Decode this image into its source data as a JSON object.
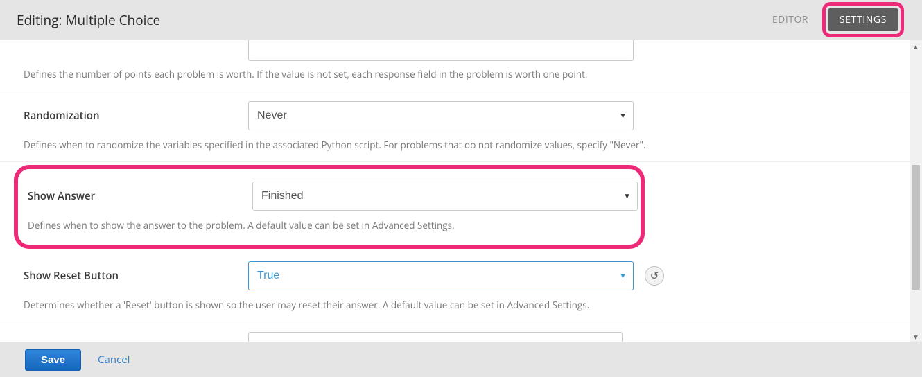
{
  "header": {
    "title": "Editing: Multiple Choice",
    "tabs": {
      "editor": "EDITOR",
      "settings": "SETTINGS"
    }
  },
  "settings": {
    "problem_weight": {
      "value": "",
      "help": "Defines the number of points each problem is worth. If the value is not set, each response field in the problem is worth one point."
    },
    "randomization": {
      "label": "Randomization",
      "value": "Never",
      "help": "Defines when to randomize the variables specified in the associated Python script. For problems that do not randomize values, specify \"Never\"."
    },
    "show_answer": {
      "label": "Show Answer",
      "value": "Finished",
      "help": "Defines when to show the answer to the problem. A default value can be set in Advanced Settings."
    },
    "show_reset": {
      "label": "Show Reset Button",
      "value": "True",
      "help": "Determines whether a 'Reset' button is shown so the user may reset their answer. A default value can be set in Advanced Settings."
    }
  },
  "footer": {
    "save": "Save",
    "cancel": "Cancel"
  },
  "colors": {
    "highlight": "#ec2a77",
    "link": "#2d80cf"
  }
}
